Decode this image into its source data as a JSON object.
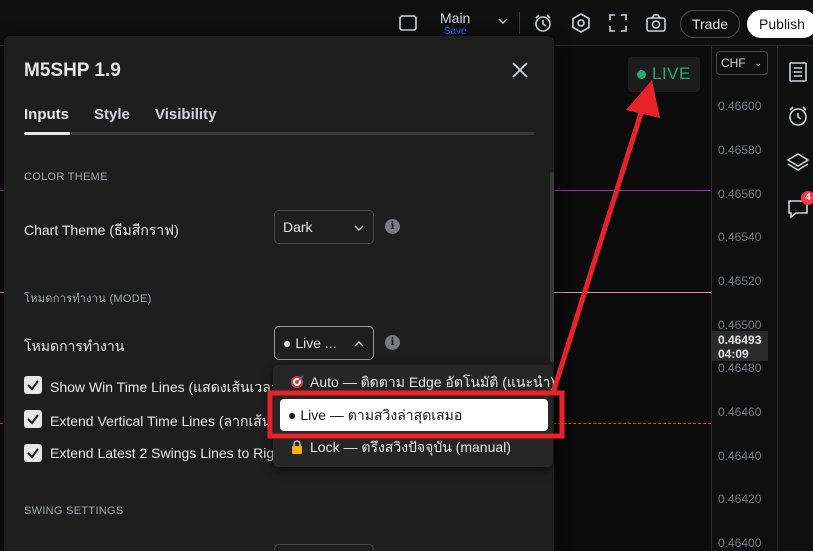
{
  "topbar": {
    "layout_name": "Main",
    "layout_status": "Save",
    "trade_label": "Trade",
    "publish_label": "Publish",
    "icons": [
      "square-icon",
      "alert-clock-icon",
      "settings-hexagon-icon",
      "fullscreen-icon",
      "camera-icon"
    ]
  },
  "chart": {
    "live_badge": "LIVE",
    "colors": {
      "live": "#26a96c",
      "purple_line": "#9c27b0",
      "pink_line": "#e58bb0",
      "red_dashed": "#f23645"
    }
  },
  "axis": {
    "currency": "CHF",
    "ticks": [
      "0.46600",
      "0.46580",
      "0.46560",
      "0.46540",
      "0.46520",
      "0.46500",
      "0.46480",
      "0.46460",
      "0.46440",
      "0.46420",
      "0.46400"
    ],
    "current_price": "0.46493",
    "countdown": "04:09"
  },
  "rightbar": {
    "icons": [
      "watchlist-icon",
      "alert-clock-icon",
      "layers-icon",
      "chat-icon"
    ],
    "notification_count": "4"
  },
  "dialog": {
    "title": "M5SHP 1.9",
    "tabs": [
      "Inputs",
      "Style",
      "Visibility"
    ],
    "active_tab": "Inputs",
    "sections": {
      "color_theme": "COLOR THEME",
      "mode": "โหมดการทำงาน (MODE)",
      "swing": "SWING SETTINGS"
    },
    "chart_theme": {
      "label": "Chart Theme (ธีมสีกราฟ)",
      "value": "Dark"
    },
    "mode": {
      "label": "โหมดการทำงาน",
      "value": "● Live ..."
    },
    "checkboxes": [
      {
        "label": "Show Win Time Lines (แสดงเส้นเวลา",
        "checked": true
      },
      {
        "label": "Extend Vertical Time Lines (ลากเส้น",
        "checked": true
      },
      {
        "label": "Extend Latest 2 Swings Lines to Rig",
        "checked": true
      }
    ],
    "dropdown_options": [
      {
        "label": "Auto — ติดตาม Edge อัตโนมัติ (แนะนำ)",
        "icon": "target-icon"
      },
      {
        "label": "● Live — ตามสวิงล่าสุดเสมอ",
        "selected": true
      },
      {
        "label": "Lock — ตรึงสวิงปัจจุบัน (manual)",
        "icon": "lock-icon"
      }
    ]
  },
  "annotation": {
    "color": "#e8222a"
  }
}
